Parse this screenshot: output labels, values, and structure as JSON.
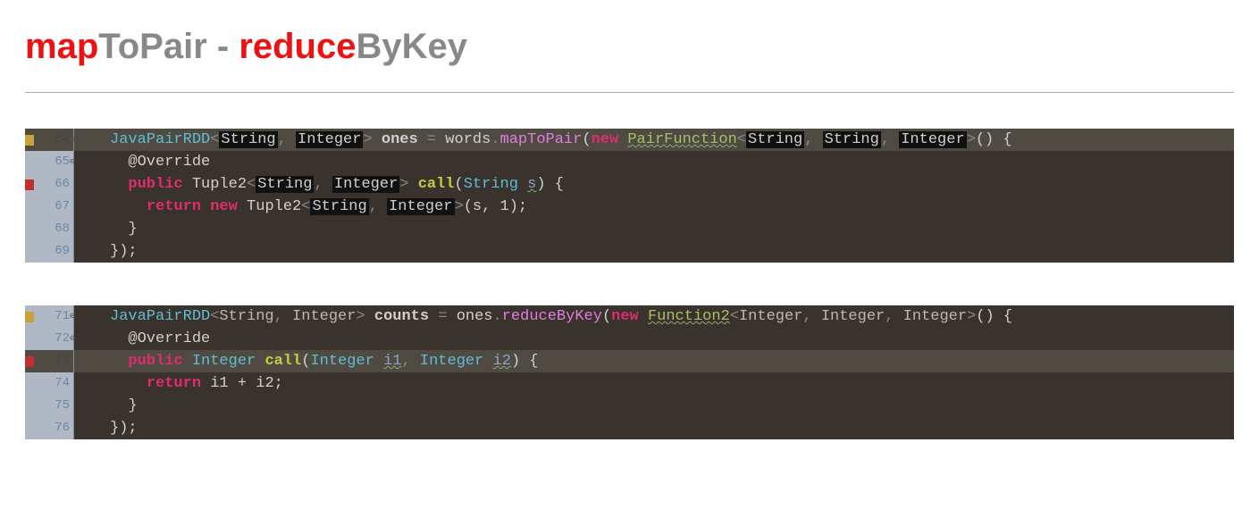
{
  "title": {
    "p1": "map",
    "p2": "ToPair - ",
    "p3": "reduce",
    "p4": "ByKey"
  },
  "block1": {
    "lines": [
      64,
      65,
      66,
      67,
      68,
      69
    ],
    "l64": {
      "t_type": "JavaPairRDD",
      "t_lt": "<",
      "t_g1": "String",
      "t_c1": ", ",
      "t_g2b": "Integer",
      "t_gt": ">",
      "t_sp": " ",
      "t_var": "ones",
      "t_eq": " = ",
      "t_w": "words",
      "t_dot": ".",
      "t_m": "mapToPair",
      "t_lp": "(",
      "t_new": "new ",
      "t_cls": "PairFunction",
      "t_lt2": "<",
      "t_g3": "String",
      "t_c2": ", ",
      "t_g4": "String",
      "t_c3": ", ",
      "t_g5": "Integer",
      "t_gt2": ">",
      "t_lp2": "()",
      "t_sp2": " ",
      "t_lb": "{"
    },
    "l65": {
      "t_ann": "@Override"
    },
    "l66": {
      "t_pub": "public ",
      "t_ret": "Tuple2",
      "t_lt": "<",
      "t_g1": "String",
      "t_c": ", ",
      "t_g2b": "Integer",
      "t_gt": "> ",
      "t_fn": "call",
      "t_lp": "(",
      "t_pt": "String ",
      "t_pn": "s",
      "t_rp": ") {"
    },
    "l67": {
      "t_ret": "return ",
      "t_new": "new ",
      "t_cls": "Tuple2",
      "t_lt": "<",
      "t_g1": "String",
      "t_c": ", ",
      "t_g2b": "Integer",
      "t_gt": ">",
      "t_args": "(s, 1);"
    },
    "l68": {
      "t": "}"
    },
    "l69": {
      "t": "});"
    }
  },
  "block2": {
    "lines": [
      71,
      72,
      73,
      74,
      75,
      76
    ],
    "l71": {
      "t_type": "JavaPairRDD",
      "t_lt": "<",
      "t_g1": "String",
      "t_c1": ", ",
      "t_g2": "Integer",
      "t_gt": "> ",
      "t_var": "counts",
      "t_eq": " = ",
      "t_w": "ones",
      "t_dot": ".",
      "t_m": "reduceByKey",
      "t_lp": "(",
      "t_new": "new ",
      "t_cls": "Function2",
      "t_lt2": "<",
      "t_g3": "Integer",
      "t_c2": ", ",
      "t_g4": "Integer",
      "t_c3": ", ",
      "t_g5": "Integer",
      "t_gt2": ">",
      "t_lp2": "()",
      "t_sp": " ",
      "t_lb": "{"
    },
    "l72": {
      "t_ann": "@Override"
    },
    "l73": {
      "t_pub": "public ",
      "t_ret": "Integer ",
      "t_fn": "call",
      "t_lp": "(",
      "t_pt1": "Integer ",
      "t_pn1": "i1",
      "t_c": ", ",
      "t_pt2": "Integer ",
      "t_pn2": "i2",
      "t_rp": ") {"
    },
    "l74": {
      "t_ret": "return ",
      "t_expr": "i1 + i2;"
    },
    "l75": {
      "t": "}"
    },
    "l76": {
      "t": "});"
    }
  }
}
